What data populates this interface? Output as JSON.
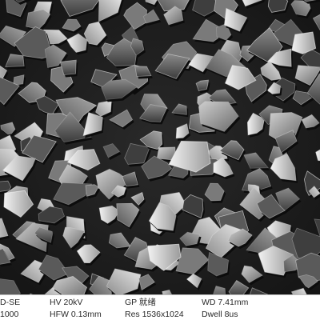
{
  "image": {
    "subject": "sem-micrograph-angular-grains"
  },
  "info_bar": {
    "row1": {
      "detector": "D-SE",
      "voltage": "HV 20kV",
      "gp": "GP 就绪",
      "working_distance": "WD 7.41mm"
    },
    "row2": {
      "magnification": "1000",
      "field_width": "HFW 0.13mm",
      "resolution": "Res 1536x1024",
      "dwell": "Dwell 8us"
    }
  }
}
